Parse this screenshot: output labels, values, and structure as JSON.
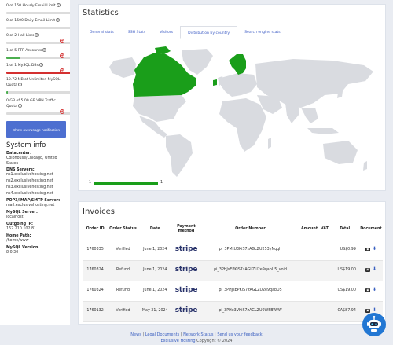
{
  "sidebar": {
    "quotas": [
      {
        "text": "0 of 150 Hourly Email Limit",
        "fill_pct": 0,
        "fill_color": "#4caf50",
        "addable": false
      },
      {
        "text": "0 of 1500 Daily Email Limit",
        "fill_pct": 0,
        "fill_color": "#4caf50",
        "addable": false
      },
      {
        "text": "0 of 2 Hall Lists",
        "fill_pct": 0,
        "fill_color": "#4caf50",
        "addable": true
      },
      {
        "text": "1 of 5 FTP Accounts",
        "fill_pct": 20,
        "fill_color": "#4caf50",
        "addable": true
      },
      {
        "text": "1 of 1 MySQL DBs",
        "fill_pct": 100,
        "fill_color": "#d43030",
        "addable": true
      },
      {
        "text": "10.72 MB of Unlimited MySQL Quota",
        "fill_pct": 2,
        "fill_color": "#4caf50",
        "addable": false
      },
      {
        "text": "0 GB of 5.00 GB VPN Traffic Quota",
        "fill_pct": 0,
        "fill_color": "#4caf50",
        "addable": true
      }
    ],
    "overage_button": "Show overusage notification",
    "system_info_title": "System info",
    "datacenter_label": "Datacenter:",
    "datacenter_value": "Colohouse/Chicago, United States",
    "dns_label": "DNS Servers:",
    "dns_servers": [
      "ns1.exclusivehosting.net",
      "ns2.exclusivehosting.net",
      "ns3.exclusivehosting.net",
      "ns4.exclusivehosting.net"
    ],
    "mail_label": "POP3/IMAP/SMTP Server:",
    "mail_value": "mail.exclusivehosting.net",
    "mysql_server_label": "MySQL Server:",
    "mysql_server_value": "localhost",
    "outgoing_ip_label": "Outgoing IP:",
    "outgoing_ip_value": "162.210.102.81",
    "home_path_label": "Home Path:",
    "home_path_value": "/home/www",
    "mysql_version_label": "MySQL Version:",
    "mysql_version_value": "8.0.30"
  },
  "statistics": {
    "title": "Statistics",
    "tabs": [
      "General stats",
      "SSH Stats",
      "Visitors",
      "Distribution by country",
      "Search engine stats"
    ],
    "active_tab": 3,
    "highlight_color": "#1a9e1a",
    "land_color": "#d9dbe0",
    "legend_min": "1",
    "legend_max": "1",
    "highlighted_countries": [
      "Canada",
      "Sweden",
      "Finland",
      "Norway",
      "Ireland"
    ]
  },
  "invoices": {
    "title": "Invoices",
    "headers": [
      "Order ID",
      "Order Status",
      "Date",
      "Payment method",
      "Order Number",
      "Amount",
      "VAT",
      "Total",
      "Document"
    ],
    "rows": [
      {
        "id": "1760335",
        "status": "Verified",
        "date": "June 1, 2024",
        "method": "stripe",
        "number": "pi_3PMtU3KiS7zAGLZU253yNqqh",
        "amount": "",
        "vat": "",
        "total": "US$0.99"
      },
      {
        "id": "1760324",
        "status": "Refund",
        "date": "June 1, 2024",
        "method": "stripe",
        "number": "pi_3PHJsEPKiS7zAGLZU2e9qabU5_void",
        "amount": "",
        "vat": "",
        "total": "US$19.00"
      },
      {
        "id": "1760324",
        "status": "Refund",
        "date": "June 1, 2024",
        "method": "stripe",
        "number": "pi_3PHJsEPKiS7zAGLZU2e9qabU5",
        "amount": "",
        "vat": "",
        "total": "US$19.00"
      },
      {
        "id": "1760132",
        "status": "Verified",
        "date": "May 31, 2024",
        "method": "stripe",
        "number": "pi_3PHe3VKiS7zAGLZU0W5BWfW",
        "amount": "",
        "vat": "",
        "total": "CA$87.94"
      }
    ]
  },
  "footer": {
    "links": [
      "News",
      "Legal Documents",
      "Network Status",
      "Send us your feedback"
    ],
    "separator": " | ",
    "brand": "Exclusive Hosting",
    "copyright": "Copyright © 2024"
  }
}
